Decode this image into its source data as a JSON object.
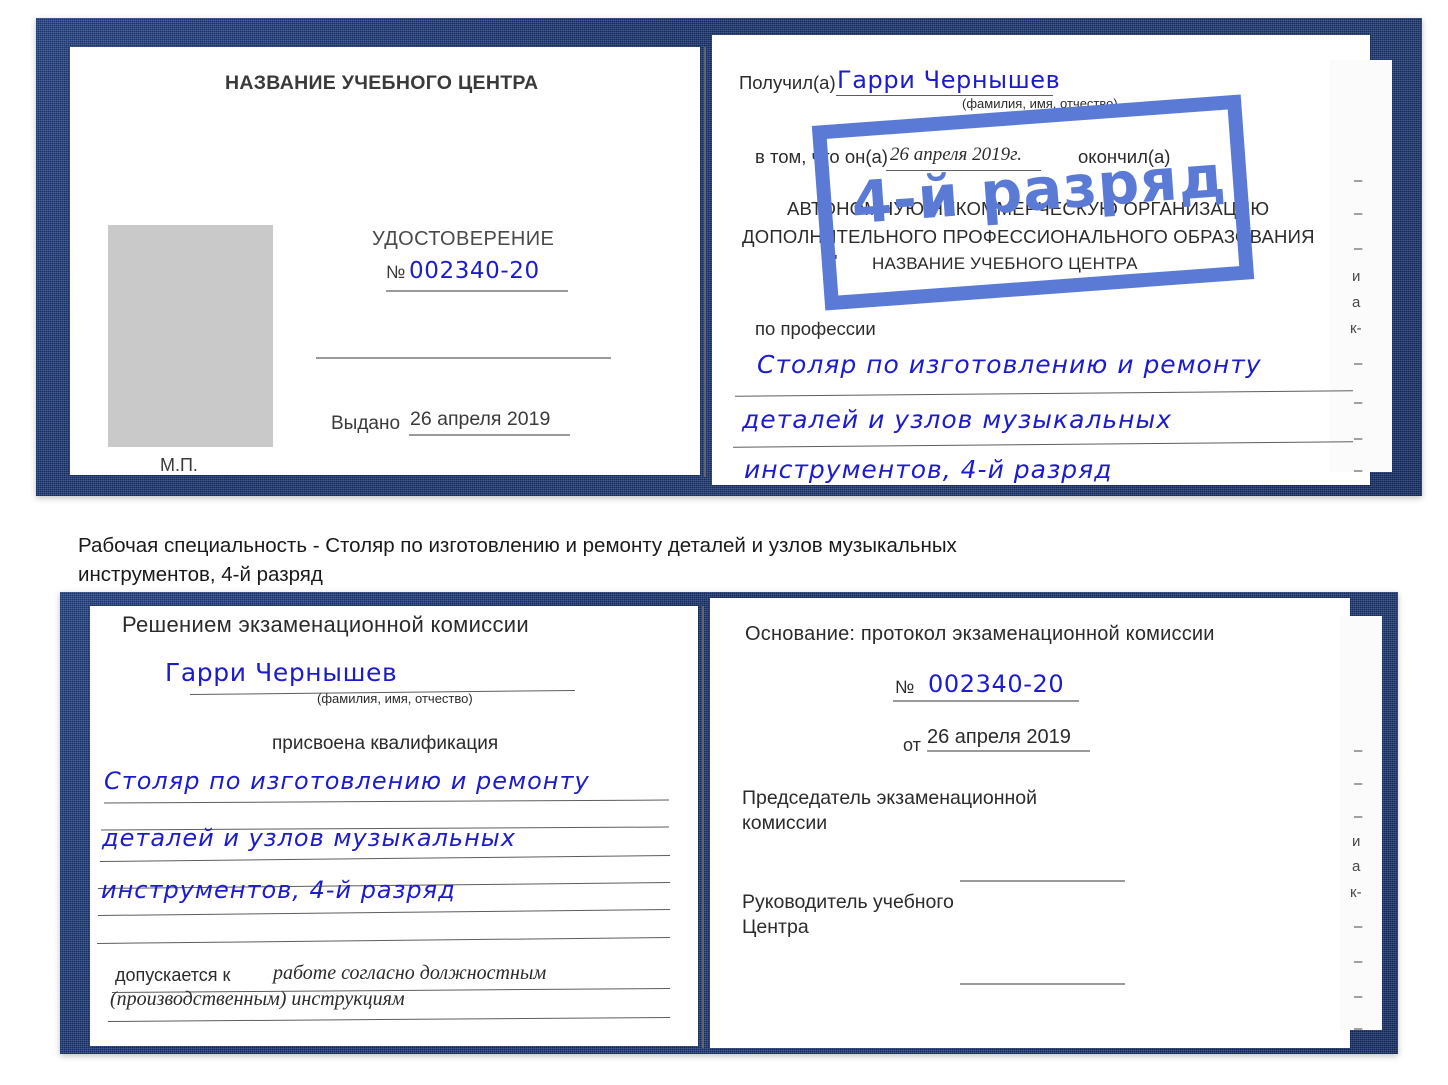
{
  "caption": {
    "text": "Рабочая специальность - Столяр по изготовлению и ремонту деталей и узлов музыкальных инструментов, 4-й разряд"
  },
  "watermark": {
    "label": "4-й разряд",
    "color": "#5b7ad6"
  },
  "colors": {
    "cover": "#23407f",
    "handwriting": "#1c1ccd",
    "print_text": "#262626",
    "rule": "#9a9a9a",
    "photo_placeholder": "#c9c9c9"
  },
  "certificate_top": {
    "left_page": {
      "heading": "НАЗВАНИЕ УЧЕБНОГО ЦЕНТРА",
      "doc_title": "УДОСТОВЕРЕНИЕ",
      "number_symbol": "№",
      "number_value": "002340-20",
      "issued_label": "Выдано",
      "issued_value": "26 апреля 2019",
      "seal_label": "М.П.",
      "photo_placeholder_name": "photo-placeholder"
    },
    "right_page": {
      "received_label": "Получил(а)",
      "received_value": "Гарри Чернышев",
      "name_hint": "(фамилия, имя, отчество)",
      "in_that_label": "в том, что он(а)",
      "completion_date": "26 апреля 2019г.",
      "finished_label": "окончил(а)",
      "org_line1": "АВТОНОМНУЮ НЕКОММЕРЧЕСКУЮ ОРГАНИЗАЦИЮ",
      "org_line2": "ДОПОЛНИТЕЛЬНОГО ПРОФЕССИОНАЛЬНОГО ОБРАЗОВАНИЯ",
      "org_quote_open": "\"",
      "org_name": "НАЗВАНИЕ УЧЕБНОГО ЦЕНТРА",
      "org_quote_close": "\"",
      "profession_label": "по профессии",
      "profession_line1": "Столяр по изготовлению и ремонту",
      "profession_line2": "деталей и узлов музыкальных",
      "profession_line3": "инструментов, 4-й разряд",
      "edge_fragments": [
        "–",
        "–",
        "–",
        "и",
        "а",
        "к-",
        "–",
        "–",
        "–",
        "–"
      ]
    }
  },
  "certificate_bottom": {
    "left_page": {
      "heading": "Решением экзаменационной комиссии",
      "name_value": "Гарри Чернышев",
      "name_hint": "(фамилия, имя, отчество)",
      "qualification_label": "присвоена квалификация",
      "qualification_line1": "Столяр по изготовлению и ремонту",
      "qualification_line2": "деталей и узлов музыкальных",
      "qualification_line3": "инструментов, 4-й разряд",
      "admitted_label": "допускается к",
      "admitted_value_line1": "работе согласно должностным",
      "admitted_value_line2": "(производственным) инструкциям"
    },
    "right_page": {
      "basis_label": "Основание: протокол экзаменационной комиссии",
      "number_symbol": "№",
      "number_value": "002340-20",
      "date_label": "от",
      "date_value": "26 апреля 2019",
      "chairman_line1": "Председатель экзаменационной",
      "chairman_line2": "комиссии",
      "head_line1": "Руководитель учебного",
      "head_line2": "Центра",
      "edge_fragments": [
        "–",
        "–",
        "–",
        "и",
        "а",
        "к-",
        "–",
        "–",
        "–",
        "–"
      ]
    }
  }
}
